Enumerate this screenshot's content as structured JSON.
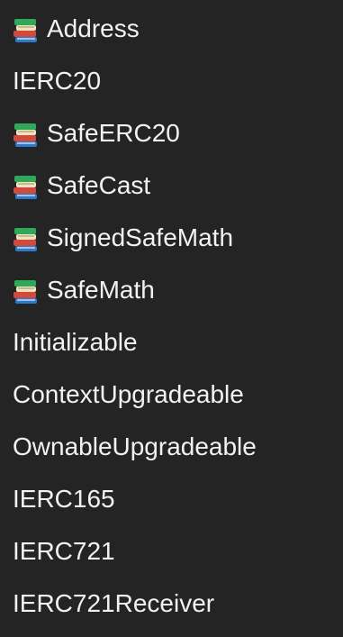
{
  "items": [
    {
      "label": "Address",
      "icon": "library-books-icon"
    },
    {
      "label": "IERC20",
      "icon": null
    },
    {
      "label": "SafeERC20",
      "icon": "library-books-icon"
    },
    {
      "label": "SafeCast",
      "icon": "library-books-icon"
    },
    {
      "label": "SignedSafeMath",
      "icon": "library-books-icon"
    },
    {
      "label": "SafeMath",
      "icon": "library-books-icon"
    },
    {
      "label": "Initializable",
      "icon": null
    },
    {
      "label": "ContextUpgradeable",
      "icon": null
    },
    {
      "label": "OwnableUpgradeable",
      "icon": null
    },
    {
      "label": "IERC165",
      "icon": null
    },
    {
      "label": "IERC721",
      "icon": null
    },
    {
      "label": "IERC721Receiver",
      "icon": null
    }
  ],
  "colors": {
    "background": "#242424",
    "text": "#f2f2f2",
    "book_green": "#2fa85a",
    "book_red": "#d14a3b",
    "book_pages": "#e9d7a6"
  }
}
